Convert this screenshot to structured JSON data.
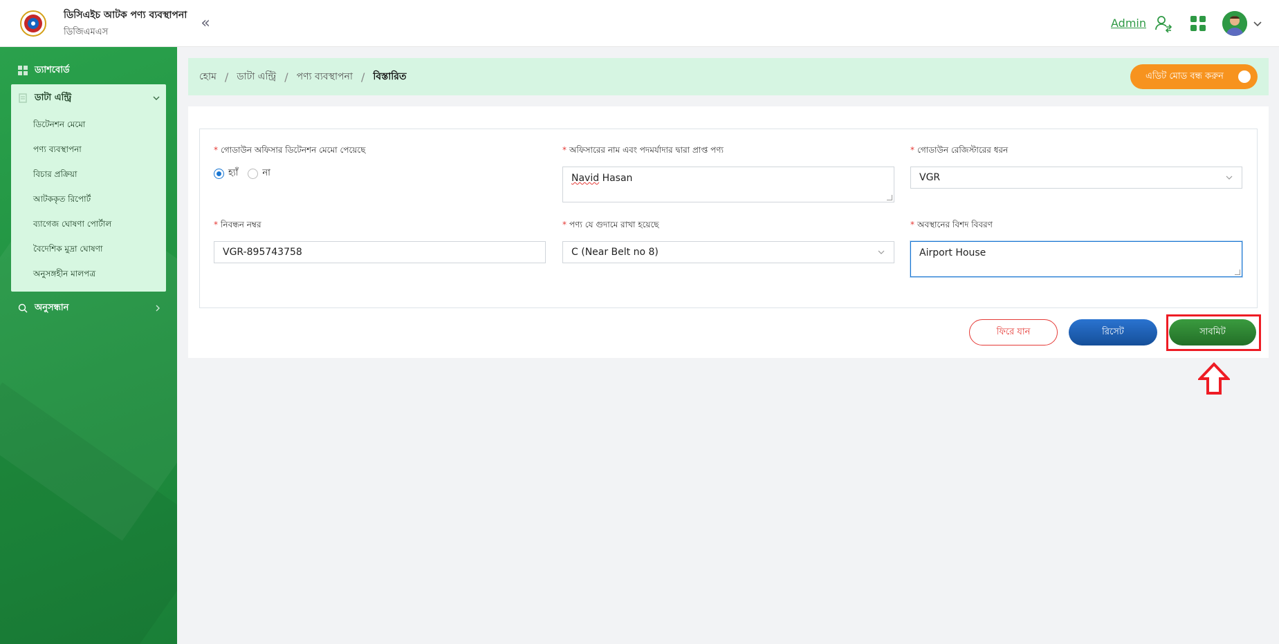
{
  "header": {
    "title": "ডিসিএইচ আটক পণ্য ব্যবস্থাপনা",
    "subtitle": "ডিজিএমএস",
    "user_label": "Admin"
  },
  "sidebar": {
    "dashboard": "ড্যাশবোর্ড",
    "data_entry": "ডাটা এন্ট্রি",
    "sub_items": [
      "ডিটেনশন মেমো",
      "পণ্য ব্যবস্থাপনা",
      "বিচার প্রক্রিয়া",
      "আটককৃত রিপোর্ট",
      "ব্যাগেজ ঘোষণা পোর্টাল",
      "বৈদেশিক মুদ্রা ঘোষণা",
      "অনুসঙ্গহীন মালপত্র"
    ],
    "search": "অনুসন্ধান"
  },
  "breadcrumb": {
    "items": [
      "হোম",
      "ডাটা এন্ট্রি",
      "পণ্য ব্যবস্থাপনা"
    ],
    "current": "বিস্তারিত",
    "separator": "/"
  },
  "edit_mode_label": "এডিট মোড বন্ধ করুন",
  "form": {
    "memo_received": {
      "label": "গোডাউন অফিসার ডিটেনশন মেমো পেয়েছে",
      "yes": "হ্যাঁ",
      "no": "না",
      "selected": "yes"
    },
    "officer_name": {
      "label": "অফিসারের নাম এবং পদমর্যাদার দ্বারা প্রাপ্ত পণ্য",
      "value_first": "Navid",
      "value_rest": " Hasan"
    },
    "register_type": {
      "label": "গোডাউন রেজিস্টারের ধরন",
      "value": "VGR"
    },
    "registration_no": {
      "label": "নিবন্ধন নম্বর",
      "value": "VGR-895743758"
    },
    "warehouse": {
      "label": "পণ্য যে গুদামে রাখা হয়েছে",
      "value": "C (Near Belt no 8)"
    },
    "location_detail": {
      "label": "অবস্থানের বিশদ বিবরণ",
      "value": "Airport House"
    },
    "required_mark": "*"
  },
  "buttons": {
    "back": "ফিরে যান",
    "reset": "রিসেট",
    "submit": "সাবমিট"
  },
  "colors": {
    "primary_green": "#2e9944",
    "orange": "#f7931e",
    "blue": "#1a5fb4",
    "annotation_red": "#ee1c24"
  }
}
